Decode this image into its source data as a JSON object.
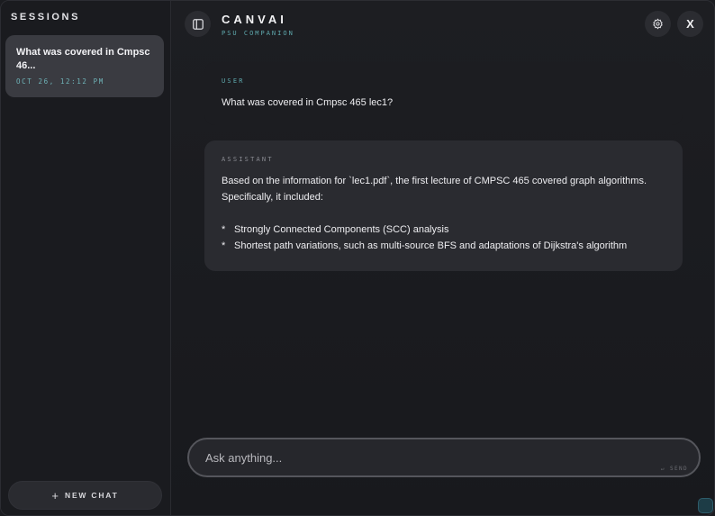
{
  "sidebar": {
    "title": "SESSIONS",
    "sessions": [
      {
        "title": "What was covered in Cmpsc 46...",
        "date": "OCT 26, 12:12 PM"
      }
    ],
    "new_chat_icon": "+",
    "new_chat_label": "NEW CHAT"
  },
  "header": {
    "brand": "CANVAI",
    "subtitle": "PSU COMPANION",
    "close_label": "X"
  },
  "messages": [
    {
      "role": "USER",
      "lines": [
        "What was covered in Cmpsc 465 lec1?"
      ]
    },
    {
      "role": "ASSISTANT",
      "lines": [
        "Based on the information for `lec1.pdf`, the first lecture of CMPSC 465 covered graph algorithms.",
        "Specifically, it included:"
      ],
      "bullets": [
        "Strongly Connected Components (SCC) analysis",
        "Shortest path variations, such as multi-source BFS and adaptations of Dijkstra's algorithm"
      ],
      "bullet_mark": "*"
    }
  ],
  "composer": {
    "placeholder": "Ask anything...",
    "send_label": "↵ SEND"
  },
  "colors": {
    "accent": "#5fa9ae",
    "sidebar_bg": "#1a1b1f",
    "session_bg": "#3a3b41",
    "assistant_bg": "#2a2b30"
  }
}
